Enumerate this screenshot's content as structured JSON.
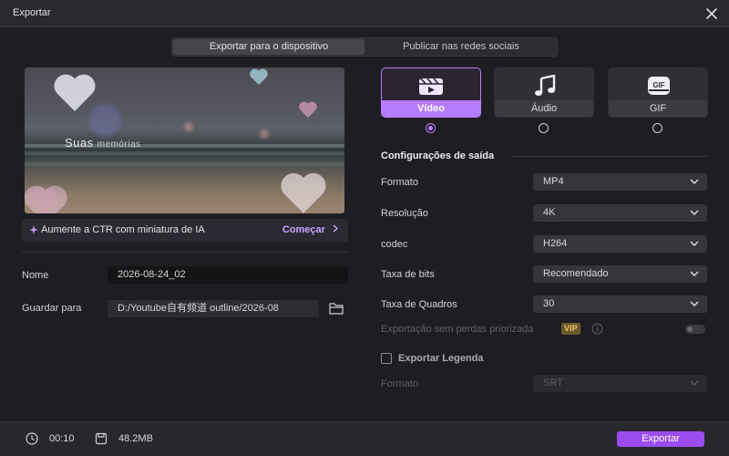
{
  "window": {
    "title": "Exportar"
  },
  "tabs": [
    {
      "label": "Exportar para o dispositivo",
      "active": true
    },
    {
      "label": "Publicar nas redes sociais",
      "active": false
    }
  ],
  "preview": {
    "overlay_text": "Suas",
    "overlay_text_small": "memórias"
  },
  "ai_banner": {
    "label": "Aumente a CTR com miniatura de IA",
    "action": "Começar"
  },
  "name_field": {
    "label": "Nome",
    "value": "2026-08-24_02"
  },
  "save_field": {
    "label": "Guardar para",
    "value": "D:/Youtube自有频道 outline/2026-08"
  },
  "export_types": [
    {
      "label": "Vídeo",
      "icon": "video-clapper-icon",
      "selected": true
    },
    {
      "label": "Áudio",
      "icon": "music-note-icon",
      "selected": false
    },
    {
      "label": "GIF",
      "icon": "gif-icon",
      "icon_text": "GIF",
      "selected": false
    }
  ],
  "output_settings": {
    "title": "Configurações de saída",
    "rows": [
      {
        "label": "Formato",
        "value": "MP4"
      },
      {
        "label": "Resolução",
        "value": "4K"
      },
      {
        "label": "codec",
        "value": "H264"
      },
      {
        "label": "Taxa de bits",
        "value": "Recomendado"
      },
      {
        "label": "Taxa de Quadros",
        "value": "30"
      }
    ],
    "lossless": {
      "label": "Exportação sem perdas priorizada",
      "badge": "VIP",
      "enabled": false
    },
    "subtitle": {
      "label": "Exportar Legenda",
      "checked": false
    },
    "subtitle_format": {
      "label": "Formato",
      "value": "SRT"
    }
  },
  "footer": {
    "duration": "00:10",
    "size": "48.2MB",
    "export_label": "Exportar"
  },
  "colors": {
    "accent": "#b57cff",
    "export_button": "#9b4cf0",
    "background": "#1e1e22"
  }
}
